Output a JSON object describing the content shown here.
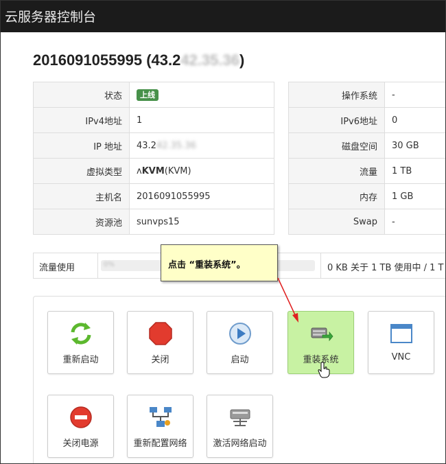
{
  "header": {
    "title": "云服务器控制台"
  },
  "server": {
    "id": "2016091055995",
    "ip_prefix": "(43.2",
    "ip_hidden": "42.35.36",
    "ip_suffix": ")"
  },
  "info_left": [
    {
      "key": "状态",
      "badge": "上线"
    },
    {
      "key": "IPv4地址",
      "value": "1"
    },
    {
      "key": "IP 地址",
      "value": "43.2",
      "hidden": "42.35.36"
    },
    {
      "key": "虚拟类型",
      "prefix": "ʌ",
      "value_bold": "KVM",
      "value": "(KVM)"
    },
    {
      "key": "主机名",
      "value": "2016091055995"
    },
    {
      "key": "资源池",
      "value": "sunvps15"
    }
  ],
  "info_right": [
    {
      "key": "操作系统",
      "value": "-"
    },
    {
      "key": "IPv6地址",
      "value": "0"
    },
    {
      "key": "磁盘空间",
      "value": "30 GB"
    },
    {
      "key": "流量",
      "value": "1 TB"
    },
    {
      "key": "内存",
      "value": "1 GB"
    },
    {
      "key": "Swap",
      "value": "-"
    }
  ],
  "traffic": {
    "label": "流量使用",
    "bar_text": "0%",
    "used_fraction": 0,
    "summary": "0 KB 关于 1 TB 使用中 / 1 T"
  },
  "callout": {
    "text": "点击 “重装系统”。"
  },
  "actions": [
    {
      "label": "重新启动",
      "icon": "restart-icon"
    },
    {
      "label": "关闭",
      "icon": "stop-icon"
    },
    {
      "label": "启动",
      "icon": "play-icon"
    },
    {
      "label": "重装系统",
      "icon": "reinstall-icon"
    },
    {
      "label": "VNC",
      "icon": "window-icon"
    },
    {
      "label": "关闭电源",
      "icon": "power-off-icon"
    },
    {
      "label": "重新配置网络",
      "icon": "network-icon"
    },
    {
      "label": "激活网络启动",
      "icon": "network-boot-icon"
    }
  ],
  "colors": {
    "badge_green": "#47914a",
    "highlight": "#c8f2a3",
    "callout_bg": "#ffffc8",
    "arrow": "#e02020"
  }
}
